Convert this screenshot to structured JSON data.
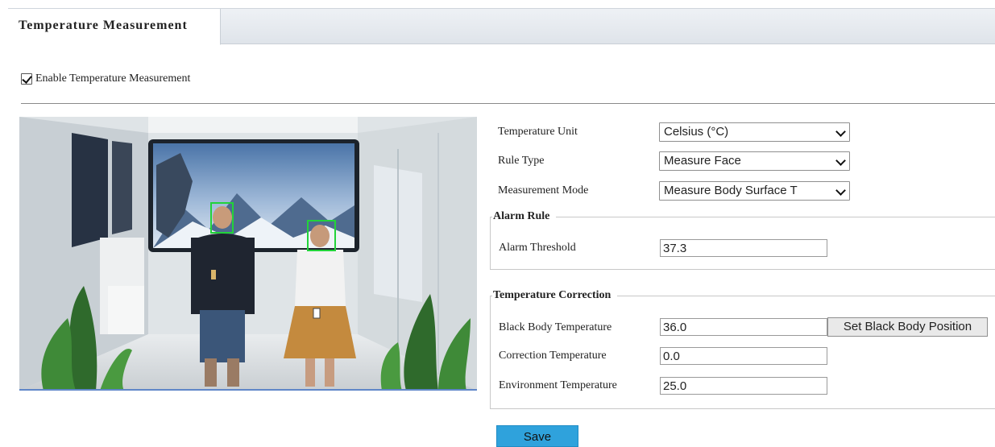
{
  "tabs": [
    {
      "label": "Temperature Measurement"
    }
  ],
  "enable": {
    "label": "Enable Temperature Measurement",
    "checked": true
  },
  "settings": {
    "temperature_unit": {
      "label": "Temperature Unit",
      "value": "Celsius (°C)"
    },
    "rule_type": {
      "label": "Rule Type",
      "value": "Measure Face"
    },
    "measurement_mode": {
      "label": "Measurement Mode",
      "value": "Measure Body Surface T"
    }
  },
  "alarm_rule": {
    "title": "Alarm Rule",
    "threshold": {
      "label": "Alarm Threshold",
      "value": "37.3"
    }
  },
  "correction": {
    "title": "Temperature Correction",
    "black_body": {
      "label": "Black Body Temperature",
      "value": "36.0"
    },
    "set_position_label": "Set Black Body Position",
    "correction_temp": {
      "label": "Correction Temperature",
      "value": "0.0"
    },
    "environment_temp": {
      "label": "Environment Temperature",
      "value": "25.0"
    }
  },
  "save_label": "Save",
  "colors": {
    "accent": "#2fa2dc",
    "face_box": "#22d33a"
  }
}
